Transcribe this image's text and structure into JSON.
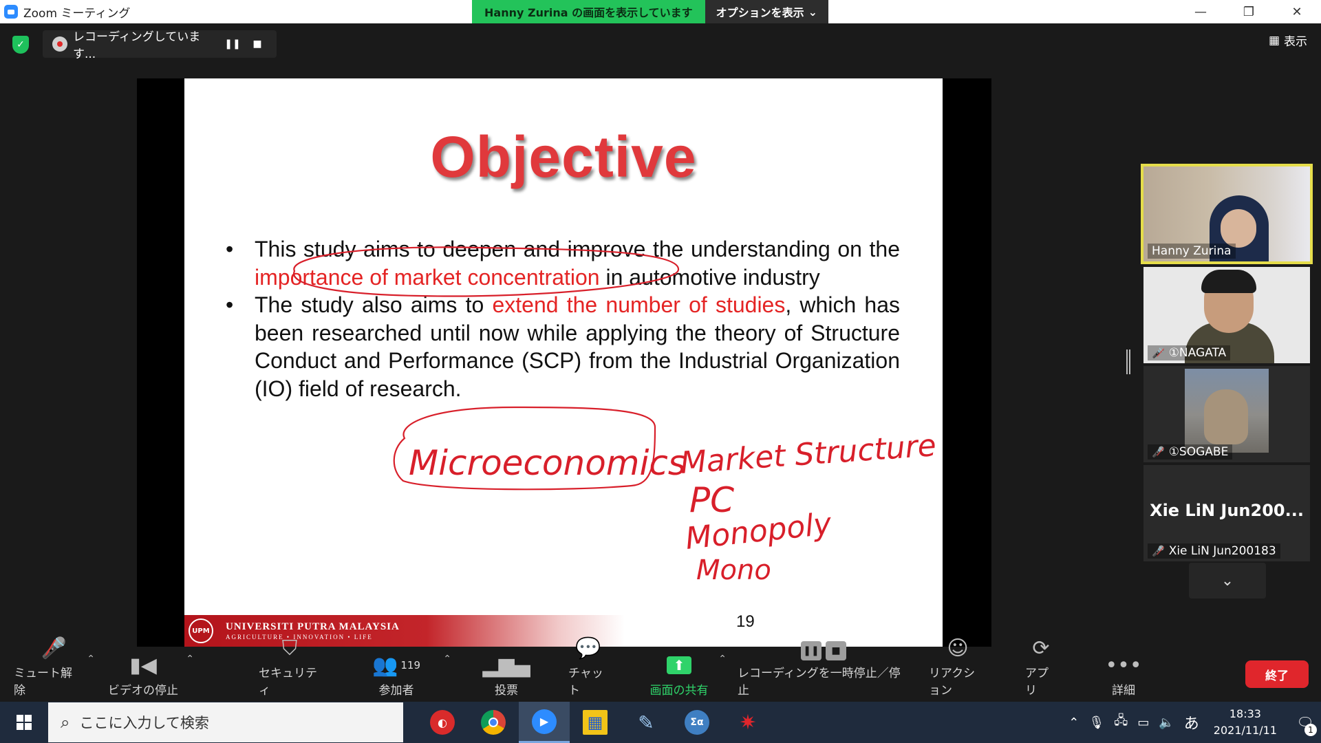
{
  "window": {
    "title": "Zoom ミーティング",
    "share_banner": "Hanny Zurina の画面を表示しています",
    "options_label": "オプションを表示",
    "minimize": "—",
    "restore": "❐",
    "close": "✕"
  },
  "recording": {
    "status": "レコーディングしています...",
    "pause_icon": "❚❚",
    "stop_icon": "■"
  },
  "view_button": "表示",
  "slide": {
    "title": "Objective",
    "bullet1_a": "This study aims to deepen and improve the understanding on the ",
    "bullet1_red": "importance of market concentration ",
    "bullet1_b": "in automotive industry",
    "bullet2_a": "The study also aims to ",
    "bullet2_red": "extend the number of studies",
    "bullet2_b": ", which has been researched until now while applying the theory of Structure Conduct and Performance (SCP) from the Industrial Organization (IO) field of research.",
    "footer_name": "UNIVERSITI PUTRA MALAYSIA",
    "footer_tagline": "AGRICULTURE • INNOVATION • LIFE",
    "footer_logo": "UPM",
    "page_number": "19",
    "annotations": [
      "Microeconomics",
      "Market Structure",
      "PC",
      "Monopoly",
      "Mono"
    ]
  },
  "participants": [
    {
      "name": "Hanny Zurina",
      "muted": false,
      "active": true
    },
    {
      "name": "①NAGATA",
      "muted": true
    },
    {
      "name": "①SOGABE",
      "muted": true
    },
    {
      "name": "Xie LiN Jun200183",
      "display": "Xie LiN Jun200...",
      "muted": true
    }
  ],
  "toolbar": {
    "mute": "ミュート解除",
    "video": "ビデオの停止",
    "security": "セキュリティ",
    "participants": "参加者",
    "participant_count": "119",
    "polls": "投票",
    "chat": "チャット",
    "share": "画面の共有",
    "recording": "レコーディングを一時停止／停止",
    "reactions": "リアクション",
    "apps": "アプリ",
    "more": "詳細",
    "end": "終了"
  },
  "taskbar": {
    "search_placeholder": "ここに入力して検索",
    "ime": "あ",
    "time": "18:33",
    "date": "2021/11/11",
    "notifications": "1"
  },
  "colors": {
    "share_green": "#23c35a",
    "slide_red": "#e42424",
    "end_red": "#e0262c",
    "active_border": "#e5dd4a"
  }
}
